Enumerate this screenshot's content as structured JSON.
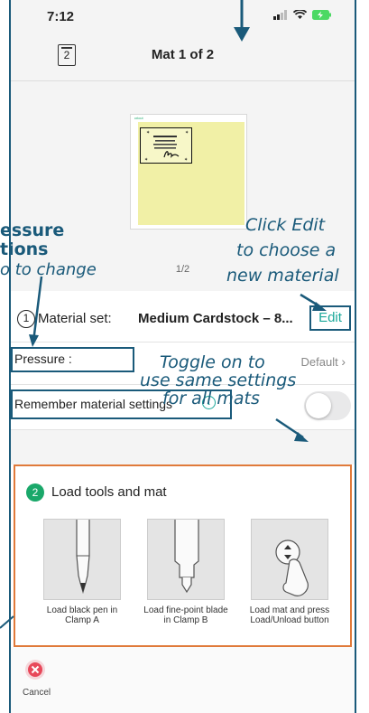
{
  "status": {
    "time": "7:12"
  },
  "nav": {
    "mat_count_icon": "2",
    "title": "Mat 1 of 2"
  },
  "preview": {
    "page_indicator": "1/2"
  },
  "material": {
    "step": "1",
    "label": "Material set:",
    "value": "Medium Cardstock – 8...",
    "edit_label": "Edit"
  },
  "pressure": {
    "label": "Pressure :",
    "value": "Default"
  },
  "remember": {
    "label": "Remember material settings",
    "info_icon": "i",
    "toggle_on": false
  },
  "load": {
    "step": "2",
    "title": "Load tools and mat",
    "cards": [
      {
        "label": "Load black pen in Clamp A",
        "icon": "pen-tool-icon"
      },
      {
        "label": "Load fine-point blade in Clamp B",
        "icon": "blade-tool-icon"
      },
      {
        "label": "Load mat and press Load/Unload button",
        "icon": "load-unload-button-icon"
      }
    ]
  },
  "tabbar": {
    "cancel_label": "Cancel"
  },
  "annotations": {
    "pressure_title_1": "essure",
    "pressure_title_2": "tions",
    "pressure_sub": "o to change",
    "edit_1": "Click Edit",
    "edit_2": "to choose a",
    "edit_3": "new material",
    "toggle_1": "Toggle on to",
    "toggle_2": "use same settings",
    "toggle_3": "for all mats"
  },
  "colors": {
    "annotation": "#1a5a7a",
    "accent": "#1aa89a",
    "panel_border": "#e07a3a",
    "step_green": "#1aa86a"
  }
}
